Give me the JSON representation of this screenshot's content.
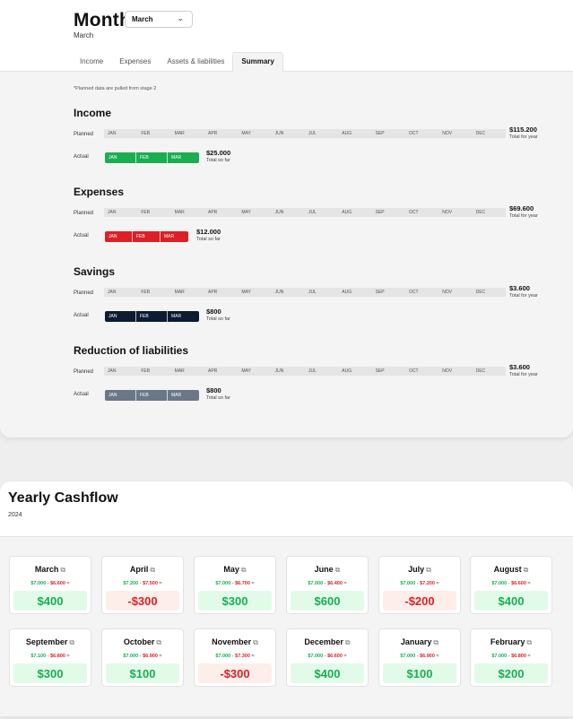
{
  "header": {
    "title": "Month",
    "month_select": "March",
    "subtitle": "March",
    "tabs": [
      "Income",
      "Expenses",
      "Assets & liabilities",
      "Summary"
    ],
    "active_tab": "Summary"
  },
  "note": "*Planned data are pulled from stage 2",
  "labels": {
    "planned": "Planned",
    "actual": "Actual",
    "total_for_year": "Total for year",
    "total_so_far": "Total so far"
  },
  "months_planned": [
    "JAN",
    "FEB",
    "MAR",
    "APR",
    "MAY",
    "JUN",
    "JUL",
    "AUG",
    "SEP",
    "OCT",
    "NOV",
    "DEC"
  ],
  "months_actual": [
    "JAN",
    "FEB",
    "MAR"
  ],
  "sections": [
    {
      "title": "Income",
      "total_year": "$115.200",
      "total_so_far": "$25.000",
      "color": "#1aae51"
    },
    {
      "title": "Expenses",
      "total_year": "$69.600",
      "total_so_far": "$12.000",
      "color": "#dd1f26"
    },
    {
      "title": "Savings",
      "total_year": "$3.600",
      "total_so_far": "$800",
      "color": "#0b1c33"
    },
    {
      "title": "Reduction of liabilities",
      "total_year": "$3.600",
      "total_so_far": "$800",
      "color": "#6a7787"
    }
  ],
  "cashflow": {
    "title": "Yearly Cashflow",
    "year": "2024",
    "months": [
      {
        "name": "March",
        "income": "$7.000",
        "expense": "$6.600",
        "result": "$400",
        "positive": true
      },
      {
        "name": "April",
        "income": "$7.200",
        "expense": "$7.500",
        "result": "-$300",
        "positive": false
      },
      {
        "name": "May",
        "income": "$7.000",
        "expense": "$6.700",
        "result": "$300",
        "positive": true
      },
      {
        "name": "June",
        "income": "$7.000",
        "expense": "$6.400",
        "result": "$600",
        "positive": true
      },
      {
        "name": "July",
        "income": "$7.000",
        "expense": "$7.200",
        "result": "-$200",
        "positive": false
      },
      {
        "name": "August",
        "income": "$7.000",
        "expense": "$6.600",
        "result": "$400",
        "positive": true
      },
      {
        "name": "September",
        "income": "$7.100",
        "expense": "$6.800",
        "result": "$300",
        "positive": true
      },
      {
        "name": "October",
        "income": "$7.000",
        "expense": "$6.900",
        "result": "$100",
        "positive": true
      },
      {
        "name": "November",
        "income": "$7.000",
        "expense": "$7.300",
        "result": "-$300",
        "positive": false
      },
      {
        "name": "December",
        "income": "$7.000",
        "expense": "$6.600",
        "result": "$400",
        "positive": true
      },
      {
        "name": "January",
        "income": "$7.000",
        "expense": "$6.900",
        "result": "$100",
        "positive": true
      },
      {
        "name": "February",
        "income": "$7.000",
        "expense": "$6.800",
        "result": "$200",
        "positive": true
      }
    ]
  },
  "colors": {
    "positive": "#1aae51",
    "negative": "#dd1f26",
    "positive_bg": "#e2fbe9",
    "negative_bg": "#fdeeea"
  },
  "icons": {
    "external_link": "external-link-icon",
    "chevron": "chevron-down-icon"
  }
}
